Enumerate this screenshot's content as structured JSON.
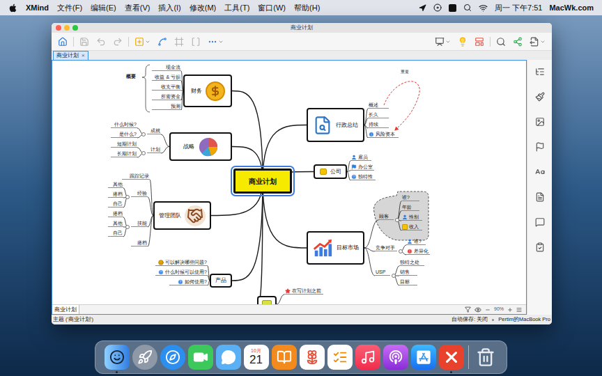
{
  "menubar": {
    "app": "XMind",
    "menus": [
      "文件(F)",
      "编辑(E)",
      "查看(V)",
      "插入(I)",
      "修改(M)",
      "工具(T)",
      "窗口(W)",
      "帮助(H)"
    ],
    "clock": "周一 下午7:51",
    "site": "MacWk.com"
  },
  "window": {
    "title": "商业计划"
  },
  "tabs": [
    {
      "label": "商业计划",
      "close": "×",
      "selected": true
    }
  ],
  "mindmap": {
    "central": "商业计划",
    "branches": [
      {
        "label": "财务",
        "summary": "概要",
        "children": [
          {
            "label": "现金流"
          },
          {
            "label": "收益 & 亏损"
          },
          {
            "label": "收支平衡"
          },
          {
            "label": "所需资金"
          },
          {
            "label": "预测"
          }
        ]
      },
      {
        "label": "战略",
        "children": [
          {
            "label": "成就",
            "children": [
              {
                "label": "什么时候?"
              },
              {
                "label": "是什么?"
              }
            ]
          },
          {
            "label": "计划",
            "children": [
              {
                "label": "短期计划"
              },
              {
                "label": "长期计划"
              }
            ]
          }
        ]
      },
      {
        "label": "管理团队",
        "children": [
          {
            "label": "跟踪记录"
          },
          {
            "label": "经验",
            "children": [
              {
                "label": "其他"
              },
              {
                "label": "搭档"
              },
              {
                "label": "自己"
              }
            ]
          },
          {
            "label": "技能",
            "children": [
              {
                "label": "搭档"
              },
              {
                "label": "其他"
              },
              {
                "label": "自己"
              }
            ]
          },
          {
            "label": "搭档"
          }
        ]
      },
      {
        "label": "产品",
        "children": [
          {
            "label": "可以解决哪些问题?",
            "marker": "smile"
          },
          {
            "label": "什么时候可以使用?",
            "marker": "question"
          },
          {
            "label": "如何使用?",
            "marker": "question"
          }
        ]
      },
      {
        "label": "行政总结",
        "relationship": {
          "label": "重要"
        },
        "children": [
          {
            "label": "概述"
          },
          {
            "label": "长久"
          },
          {
            "label": "持续"
          },
          {
            "label": "风险资本",
            "marker": "info"
          }
        ]
      },
      {
        "label": "公司",
        "children": [
          {
            "label": "雇员",
            "marker": "person"
          },
          {
            "label": "办公室",
            "marker": "flag"
          },
          {
            "label": "独特性",
            "marker": "question"
          }
        ]
      },
      {
        "label": "目标市场",
        "children": [
          {
            "label": "顾客",
            "boundary": true,
            "children": [
              {
                "label": "谁?"
              },
              {
                "label": "年龄"
              },
              {
                "label": "性别",
                "marker": "person"
              },
              {
                "label": "收入",
                "marker": "money"
              }
            ]
          },
          {
            "label": "竞争对手",
            "children": [
              {
                "label": "谁?",
                "marker": "person"
              },
              {
                "label": "差异化",
                "marker": "alert"
              }
            ]
          },
          {
            "label": "USP",
            "children": [
              {
                "label": "独特之处"
              },
              {
                "label": "销售"
              },
              {
                "label": "目标"
              }
            ]
          }
        ]
      },
      {
        "label": "",
        "children": [
          {
            "label": "在写计划之前",
            "marker": "star"
          }
        ]
      }
    ]
  },
  "sheet_bar": {
    "sheets": [
      {
        "label": "商业计划",
        "selected": true
      }
    ],
    "zoom": "90%"
  },
  "status_bar": {
    "left": "主题 ('商业计划')",
    "autosave": "自动保存: 关闭",
    "device": "Pertim的MacBook Pro"
  },
  "dock": {
    "calendar": {
      "month": "10月",
      "day": "21"
    },
    "apps": [
      {
        "running": true
      },
      {
        "running": false
      },
      {
        "running": false
      },
      {
        "running": false
      },
      {
        "running": false
      },
      {
        "running": false
      },
      {
        "running": false
      },
      {
        "running": false
      },
      {
        "running": false
      },
      {
        "running": false
      },
      {
        "running": false
      },
      {
        "running": false
      },
      {
        "running": true
      },
      {
        "running": false
      }
    ]
  }
}
